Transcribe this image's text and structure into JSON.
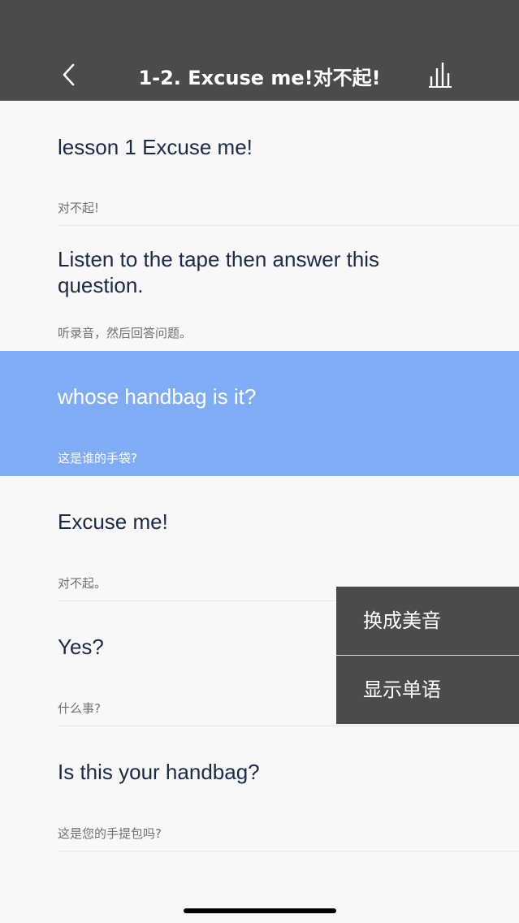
{
  "header": {
    "title": "1-2. Excuse me!对不起!",
    "back_icon": "chevron-left-icon",
    "menu_icon": "audio-bars-icon"
  },
  "sentences": [
    {
      "en": "lesson 1  Excuse me!",
      "cn": "对不起!"
    },
    {
      "en": "Listen to the tape then answer this question.",
      "cn": "听录音，然后回答问题。"
    },
    {
      "en": "whose handbag is it?",
      "cn": "这是谁的手袋?"
    },
    {
      "en": "Excuse me!",
      "cn": "对不起。"
    },
    {
      "en": "Yes?",
      "cn": "什么事?"
    },
    {
      "en": "Is this your handbag?",
      "cn": "这是您的手提包吗?"
    }
  ],
  "active_sentence_index": 2,
  "popup_menu": {
    "items": [
      {
        "label": "换成美音"
      },
      {
        "label": "显示单语"
      }
    ]
  },
  "colors": {
    "header_bg": "#4b4b4e",
    "highlight_bg": "#80acf5",
    "text_dark": "#1b2a4a",
    "text_sub": "#707070",
    "popup_bg": "#4b4b4e"
  }
}
